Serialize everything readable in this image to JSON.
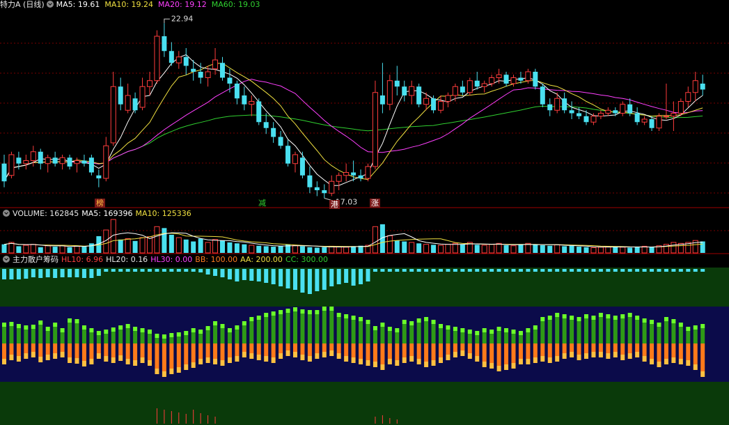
{
  "colors": {
    "up": "#ff3c3c",
    "down": "#4ae0f0",
    "ma5": "#ffffff",
    "ma10": "#f0e040",
    "ma20": "#ff40ff",
    "ma60": "#30d030",
    "grid": "#7a0000"
  },
  "main": {
    "title": "特力A (日线)",
    "ma_labels": [
      "MA5: 19.61",
      "MA10: 19.24",
      "MA20: 19.12",
      "MA60: 19.03"
    ],
    "high_label": "22.94",
    "low_label": "17.03",
    "tags": [
      "榜",
      "减",
      "港",
      "涨"
    ]
  },
  "volume": {
    "labels": [
      "VOLUME: 162845",
      "MA5: 169396",
      "MA10: 125336"
    ]
  },
  "chip": {
    "title": "主力散户筹码",
    "labels": [
      "HL10: 6.96",
      "HL20: 0.16",
      "HL30: 0.00",
      "BB: 100.00",
      "AA: 200.00",
      "CC: 300.00"
    ]
  },
  "chart_data": {
    "type": "candlestick",
    "ohlc": [
      [
        18.2,
        18.5,
        17.4,
        17.6
      ],
      [
        17.8,
        18.6,
        17.7,
        18.5
      ],
      [
        18.4,
        18.6,
        18.0,
        18.2
      ],
      [
        18.2,
        18.5,
        18.0,
        18.3
      ],
      [
        18.3,
        18.8,
        18.1,
        18.6
      ],
      [
        18.6,
        18.7,
        18.0,
        18.2
      ],
      [
        18.2,
        18.5,
        17.9,
        18.4
      ],
      [
        18.4,
        18.6,
        18.1,
        18.2
      ],
      [
        18.2,
        18.5,
        18.0,
        18.4
      ],
      [
        18.4,
        18.5,
        18.0,
        18.1
      ],
      [
        18.2,
        18.4,
        17.9,
        18.3
      ],
      [
        18.3,
        18.5,
        18.1,
        18.2
      ],
      [
        18.4,
        18.5,
        17.8,
        17.9
      ],
      [
        17.8,
        18.0,
        17.4,
        17.7
      ],
      [
        17.7,
        19.1,
        17.6,
        18.8
      ],
      [
        18.9,
        21.3,
        18.8,
        20.8
      ],
      [
        20.8,
        21.1,
        20.0,
        20.2
      ],
      [
        20.0,
        20.9,
        19.9,
        20.5
      ],
      [
        20.4,
        20.6,
        19.9,
        20.0
      ],
      [
        20.1,
        21.1,
        20.0,
        20.8
      ],
      [
        20.8,
        21.3,
        20.5,
        21.0
      ],
      [
        21.0,
        22.7,
        20.9,
        22.5
      ],
      [
        22.5,
        22.94,
        21.8,
        22.0
      ],
      [
        22.0,
        22.3,
        21.5,
        21.6
      ],
      [
        21.6,
        22.0,
        21.4,
        21.8
      ],
      [
        21.8,
        22.1,
        21.2,
        21.5
      ],
      [
        21.4,
        21.7,
        21.0,
        21.3
      ],
      [
        21.3,
        21.6,
        20.9,
        21.1
      ],
      [
        21.1,
        21.5,
        20.8,
        21.3
      ],
      [
        21.4,
        22.1,
        21.2,
        21.7
      ],
      [
        21.6,
        21.8,
        21.0,
        21.1
      ],
      [
        21.1,
        21.4,
        20.6,
        20.9
      ],
      [
        20.9,
        21.0,
        20.2,
        20.4
      ],
      [
        20.5,
        20.8,
        20.0,
        20.2
      ],
      [
        20.2,
        20.5,
        19.8,
        20.3
      ],
      [
        20.3,
        20.4,
        19.5,
        19.6
      ],
      [
        19.6,
        19.9,
        19.2,
        19.4
      ],
      [
        19.4,
        19.6,
        18.9,
        19.1
      ],
      [
        19.1,
        19.3,
        18.7,
        18.8
      ],
      [
        18.8,
        19.0,
        18.1,
        18.2
      ],
      [
        18.2,
        18.6,
        17.9,
        18.5
      ],
      [
        18.4,
        18.6,
        17.7,
        17.8
      ],
      [
        17.8,
        18.1,
        17.2,
        17.4
      ],
      [
        17.4,
        17.6,
        17.1,
        17.3
      ],
      [
        17.3,
        17.5,
        17.03,
        17.2
      ],
      [
        17.2,
        17.8,
        17.1,
        17.6
      ],
      [
        17.6,
        17.9,
        17.3,
        17.8
      ],
      [
        17.8,
        18.2,
        17.6,
        17.9
      ],
      [
        17.9,
        18.3,
        17.6,
        17.8
      ],
      [
        17.8,
        18.0,
        17.6,
        17.7
      ],
      [
        17.7,
        18.2,
        17.6,
        18.1
      ],
      [
        18.1,
        21.0,
        18.0,
        20.6
      ],
      [
        20.5,
        21.6,
        19.9,
        20.2
      ],
      [
        20.2,
        21.2,
        20.0,
        21.0
      ],
      [
        21.0,
        21.5,
        20.5,
        20.8
      ],
      [
        20.8,
        21.0,
        20.3,
        20.5
      ],
      [
        20.5,
        21.0,
        20.2,
        20.8
      ],
      [
        20.8,
        20.9,
        20.1,
        20.2
      ],
      [
        20.2,
        20.6,
        20.0,
        20.4
      ],
      [
        20.4,
        20.5,
        19.9,
        20.0
      ],
      [
        20.0,
        20.5,
        19.9,
        20.3
      ],
      [
        20.3,
        20.6,
        20.1,
        20.5
      ],
      [
        20.5,
        20.9,
        20.3,
        20.8
      ],
      [
        20.8,
        21.0,
        20.5,
        20.6
      ],
      [
        20.6,
        21.1,
        20.5,
        21.0
      ],
      [
        21.0,
        21.3,
        20.7,
        20.8
      ],
      [
        20.8,
        21.0,
        20.6,
        20.9
      ],
      [
        20.9,
        21.2,
        20.8,
        21.1
      ],
      [
        21.1,
        21.4,
        20.9,
        21.2
      ],
      [
        21.2,
        21.3,
        20.8,
        20.9
      ],
      [
        20.9,
        21.2,
        20.8,
        21.1
      ],
      [
        21.1,
        21.3,
        20.9,
        21.0
      ],
      [
        21.0,
        21.4,
        20.9,
        21.3
      ],
      [
        21.3,
        21.4,
        20.7,
        20.8
      ],
      [
        20.8,
        20.9,
        20.1,
        20.2
      ],
      [
        20.2,
        20.4,
        19.8,
        20.0
      ],
      [
        20.0,
        20.6,
        19.9,
        20.4
      ],
      [
        20.4,
        20.6,
        19.9,
        20.0
      ],
      [
        20.0,
        20.3,
        19.7,
        19.9
      ],
      [
        19.9,
        20.1,
        19.7,
        19.8
      ],
      [
        19.8,
        20.0,
        19.5,
        19.6
      ],
      [
        19.6,
        19.9,
        19.5,
        19.8
      ],
      [
        19.8,
        20.0,
        19.7,
        19.9
      ],
      [
        19.9,
        20.1,
        19.8,
        20.0
      ],
      [
        20.0,
        20.1,
        19.8,
        19.9
      ],
      [
        19.9,
        20.3,
        19.8,
        20.2
      ],
      [
        20.2,
        20.4,
        19.8,
        19.9
      ],
      [
        19.9,
        20.1,
        19.5,
        19.6
      ],
      [
        19.6,
        19.8,
        19.5,
        19.7
      ],
      [
        19.7,
        19.8,
        19.3,
        19.4
      ],
      [
        19.4,
        19.9,
        19.3,
        19.8
      ],
      [
        19.8,
        20.9,
        19.7,
        19.8
      ],
      [
        19.8,
        20.3,
        19.3,
        19.9
      ],
      [
        19.9,
        20.4,
        19.8,
        20.3
      ],
      [
        20.3,
        20.8,
        20.1,
        20.6
      ],
      [
        20.6,
        21.3,
        20.3,
        21.0
      ],
      [
        20.9,
        21.2,
        20.5,
        20.7
      ]
    ],
    "volume": [
      18,
      22,
      14,
      16,
      18,
      12,
      15,
      13,
      16,
      12,
      14,
      13,
      20,
      35,
      48,
      70,
      28,
      30,
      25,
      32,
      34,
      55,
      52,
      38,
      32,
      28,
      24,
      30,
      22,
      28,
      26,
      22,
      20,
      18,
      16,
      15,
      14,
      13,
      14,
      18,
      16,
      14,
      12,
      11,
      12,
      14,
      13,
      12,
      14,
      15,
      16,
      55,
      60,
      36,
      26,
      24,
      22,
      20,
      18,
      17,
      16,
      18,
      20,
      18,
      22,
      17,
      16,
      18,
      20,
      16,
      15,
      18,
      20,
      18,
      16,
      15,
      17,
      14,
      15,
      13,
      12,
      11,
      12,
      13,
      14,
      12,
      11,
      12,
      14,
      13,
      15,
      18,
      22,
      20,
      22,
      26,
      24
    ],
    "chip_top": [
      15,
      15,
      15,
      14,
      12,
      13,
      12,
      13,
      12,
      12,
      12,
      13,
      13,
      10,
      4,
      4,
      4,
      4,
      4,
      4,
      4,
      4,
      4,
      4,
      4,
      4,
      4,
      5,
      8,
      10,
      12,
      15,
      18,
      16,
      17,
      18,
      20,
      22,
      25,
      28,
      30,
      34,
      36,
      32,
      30,
      25,
      22,
      20,
      24,
      22,
      18,
      4,
      4,
      4,
      4,
      4,
      4,
      4,
      4,
      4,
      4,
      4,
      4,
      4,
      4,
      4,
      4,
      4,
      4,
      4,
      4,
      4,
      4,
      4,
      4,
      4,
      4,
      4,
      4,
      4,
      4,
      4,
      4,
      4,
      4,
      4,
      4,
      4,
      4,
      4,
      4,
      4,
      4,
      4,
      4,
      4,
      4
    ],
    "chip_up": [
      30,
      31,
      28,
      26,
      27,
      33,
      24,
      30,
      22,
      36,
      35,
      26,
      22,
      18,
      20,
      23,
      26,
      28,
      24,
      22,
      20,
      14,
      13,
      15,
      16,
      18,
      22,
      20,
      25,
      32,
      28,
      22,
      26,
      32,
      38,
      40,
      44,
      46,
      48,
      50,
      52,
      49,
      48,
      48,
      53,
      53,
      44,
      42,
      40,
      38,
      34,
      25,
      30,
      24,
      22,
      34,
      32,
      36,
      38,
      34,
      28,
      26,
      24,
      22,
      20,
      18,
      22,
      20,
      24,
      22,
      20,
      18,
      22,
      26,
      38,
      40,
      44,
      42,
      40,
      38,
      42,
      40,
      44,
      42,
      40,
      42,
      44,
      40,
      36,
      34,
      30,
      38,
      35,
      30,
      24,
      26,
      28
    ],
    "chip_down": [
      30,
      24,
      26,
      22,
      20,
      27,
      24,
      22,
      20,
      28,
      29,
      33,
      30,
      22,
      26,
      28,
      25,
      30,
      32,
      28,
      32,
      44,
      48,
      44,
      42,
      38,
      35,
      30,
      28,
      30,
      32,
      28,
      26,
      20,
      22,
      24,
      26,
      28,
      22,
      18,
      20,
      24,
      26,
      22,
      20,
      18,
      22,
      26,
      28,
      30,
      32,
      34,
      38,
      30,
      32,
      28,
      26,
      30,
      34,
      32,
      28,
      24,
      20,
      18,
      22,
      26,
      34,
      36,
      40,
      38,
      36,
      30,
      30,
      28,
      26,
      28,
      26,
      22,
      20,
      24,
      22,
      20,
      20,
      22,
      20,
      24,
      22,
      20,
      26,
      30,
      34,
      30,
      28,
      30,
      32,
      38,
      48
    ],
    "chip_bottom": [
      0,
      0,
      0,
      0,
      0,
      0,
      0,
      0,
      0,
      0,
      0,
      0,
      0,
      0,
      0,
      0,
      0,
      0,
      0,
      0,
      0,
      22,
      20,
      18,
      16,
      14,
      20,
      15,
      12,
      10,
      0,
      0,
      0,
      0,
      0,
      0,
      0,
      0,
      0,
      0,
      0,
      0,
      0,
      0,
      0,
      0,
      0,
      0,
      0,
      0,
      0,
      10,
      12,
      8,
      6,
      0,
      0,
      0,
      0,
      0,
      0,
      0,
      0,
      0,
      0,
      0,
      0,
      0,
      0,
      0,
      0,
      0,
      0,
      0,
      0,
      0,
      0,
      0,
      0,
      0,
      0,
      0,
      0,
      0,
      0,
      0,
      0,
      0,
      0,
      0,
      0,
      0,
      0,
      0,
      0,
      0,
      0
    ]
  }
}
